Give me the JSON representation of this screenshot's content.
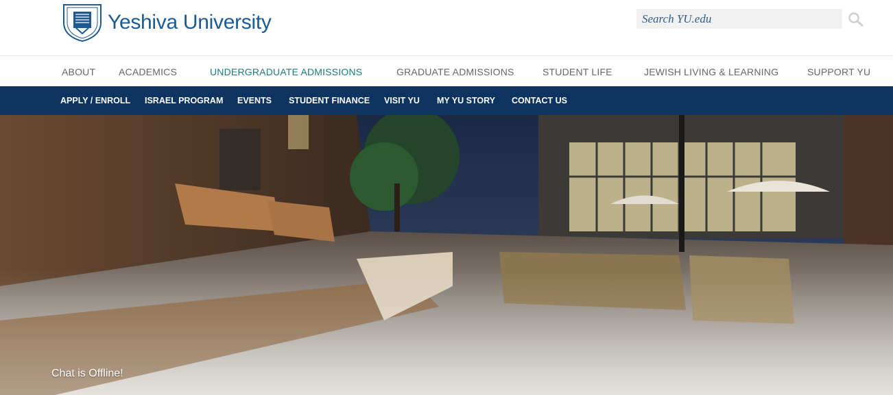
{
  "brand": {
    "name": "Yeshiva University"
  },
  "search": {
    "placeholder": "Search YU.edu"
  },
  "main_nav": [
    {
      "label": "ABOUT",
      "active": false
    },
    {
      "label": "ACADEMICS",
      "active": false
    },
    {
      "label": "UNDERGRADUATE ADMISSIONS",
      "active": true
    },
    {
      "label": "GRADUATE ADMISSIONS",
      "active": false
    },
    {
      "label": "STUDENT LIFE",
      "active": false
    },
    {
      "label": "JEWISH LIVING & LEARNING",
      "active": false
    },
    {
      "label": "SUPPORT YU",
      "active": false
    }
  ],
  "sub_nav": [
    {
      "label": "APPLY / ENROLL"
    },
    {
      "label": "ISRAEL PROGRAM"
    },
    {
      "label": "EVENTS"
    },
    {
      "label": "STUDENT FINANCE"
    },
    {
      "label": "VISIT YU"
    },
    {
      "label": "MY YU STORY"
    },
    {
      "label": "CONTACT US"
    }
  ],
  "chat": {
    "status": "Chat is Offline!"
  },
  "colors": {
    "brand_blue": "#1d5a92",
    "subnav_bg": "#0d3460",
    "active_nav": "#1f7a7a"
  },
  "icons": {
    "search": "magnifier-icon",
    "seal": "university-seal-icon"
  }
}
